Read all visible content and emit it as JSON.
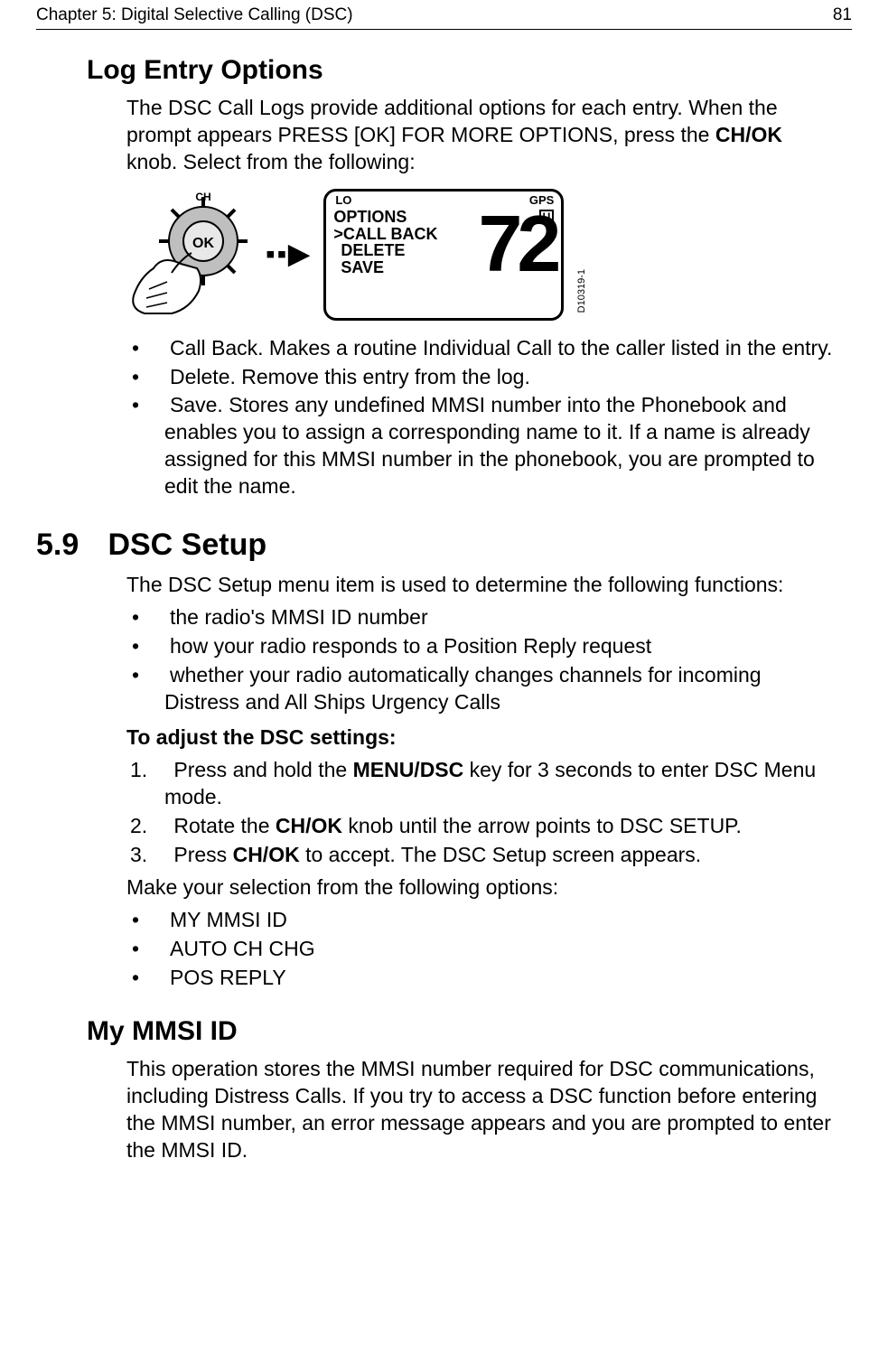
{
  "header": {
    "chapter": "Chapter 5: Digital Selective Calling (DSC)",
    "page_number": "81"
  },
  "section1": {
    "heading": "Log Entry Options",
    "intro_pre": "The DSC Call Logs provide additional options for each entry. When the prompt appears PRESS [OK] FOR MORE OPTIONS, press the ",
    "intro_bold": "CH/OK",
    "intro_post": " knob. Select from the following:",
    "bullets": [
      "Call Back. Makes a routine Individual Call to the caller listed in the entry.",
      "Delete. Remove this entry from the log.",
      "Save. Stores any undefined MMSI number into the Phonebook and enables you to assign a corresponding name to it. If a name is already assigned for this MMSI number in the phonebook, you are prompted to edit the name."
    ]
  },
  "figure": {
    "knob_label_top": "CH",
    "knob_label_center": "OK",
    "arrow": "▪▪▶",
    "lcd": {
      "top_left": "LO",
      "top_right": "GPS",
      "u_badge": "U",
      "menu": [
        "OPTIONS",
        ">CALL BACK",
        "DELETE",
        "SAVE"
      ],
      "channel": "72"
    },
    "id": "D10319-1"
  },
  "section2": {
    "number": "5.9",
    "title": "DSC Setup",
    "intro": "The DSC Setup menu item is used to determine the following functions:",
    "bullets": [
      "the radio's MMSI ID number",
      "how your radio responds to a Position Reply request",
      "whether your radio automatically changes channels for incoming Distress and All Ships Urgency Calls"
    ],
    "instruct": "To adjust the DSC settings:",
    "steps": [
      {
        "pre": "Press and hold the ",
        "bold": "MENU/DSC",
        "post": " key for 3 seconds to enter DSC Menu mode."
      },
      {
        "pre": "Rotate the ",
        "bold": "CH/OK",
        "post": " knob until the arrow points to DSC SETUP."
      },
      {
        "pre": "Press ",
        "bold": "CH/OK",
        "post": " to accept. The DSC Setup screen appears."
      }
    ],
    "post_steps": "Make your selection from the following options:",
    "options": [
      "MY MMSI ID",
      "AUTO CH CHG",
      "POS REPLY"
    ]
  },
  "section3": {
    "heading": "My MMSI ID",
    "body": "This operation stores the MMSI number required for DSC communications, including Distress Calls. If you try to access a DSC function before entering the MMSI number, an error message appears and you are prompted to enter the MMSI ID."
  }
}
